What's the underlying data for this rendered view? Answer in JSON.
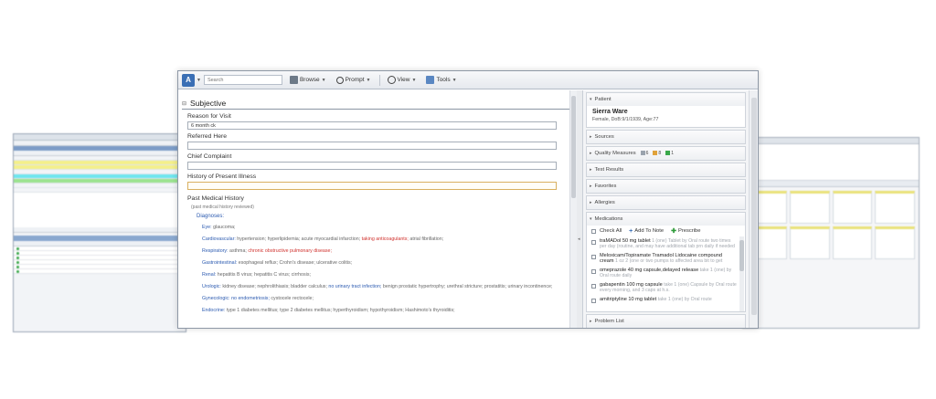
{
  "toolbar": {
    "search_placeholder": "Search",
    "browse_label": "Browse",
    "prompt_label": "Prompt",
    "view_label": "View",
    "tools_label": "Tools"
  },
  "note": {
    "section_title": "Subjective",
    "reason_label": "Reason for Visit",
    "reason_value": "6 month ck",
    "referred_label": "Referred Here",
    "chief_label": "Chief Complaint",
    "hpi_label": "History of Present Illness",
    "pmh_label": "Past Medical History",
    "pmh_sub": "(past medical history reviewed)",
    "diagnoses_label": "Diagnoses:",
    "eye": {
      "sys": "Eye:",
      "text": "glaucoma;"
    },
    "cardio": {
      "sys": "Cardiovascular:",
      "text": "hypertension;  hyperlipidemia;  acute myocardial infarction;",
      "red": "taking anticoagulants;",
      "tail": "atrial fibrillation;"
    },
    "resp": {
      "sys": "Respiratory:",
      "text": "asthma;",
      "red": "chronic obstructive pulmonary disease;"
    },
    "gi": {
      "sys": "Gastrointestinal:",
      "text": "esophageal reflux;  Crohn's disease;  ulcerative colitis;"
    },
    "renal": {
      "sys": "Renal:",
      "text": "hepatitis B virus;  hepatitis C virus;  cirrhosis;"
    },
    "uro": {
      "sys": "Urologic:",
      "text": "kidney disease;  nephrolithiasis;  bladder calculus;",
      "blue": "no urinary tract infection;",
      "tail": "benign prostatic hypertrophy;  urethral stricture;  prostatitis;",
      "tail2": "urinary incontinence;"
    },
    "gyn": {
      "sys": "Gynecologic:",
      "blue": "no endometriosis;",
      "text": "cystocele rectocele;"
    },
    "endo": {
      "sys": "Endocrine:",
      "text": "type 1 diabetes mellitus;  type 2 diabetes mellitus;  hyperthyroidism;  hypothyroidism;  Hashimoto's thyroiditis;"
    }
  },
  "panel": {
    "patient_header": "Patient",
    "patient_name": "Sierra Ware",
    "patient_info": "Female, DoB:9/1/1939, Age:77",
    "sources": "Sources",
    "quality": "Quality Measures",
    "q_counts": [
      "6",
      "8",
      "1"
    ],
    "test_results": "Test Results",
    "favorites": "Favorites",
    "allergies": "Allergies",
    "medications": "Medications",
    "check_all": "Check All",
    "add_to_note": "Add To Note",
    "prescribe": "Prescribe",
    "meds": [
      {
        "name": "traMADol 50 mg tablet",
        "sig": "1 (one) Tablet by Oral route two times per day (routine, and may have additional tab prn daily if needed"
      },
      {
        "name": "Meloxicam/Topiramate Tramadol Lidocaine compound cream",
        "sig": "1 oz 2 (one or two pumps to affected area bit to get"
      },
      {
        "name": "omeprazole 40 mg capsule,delayed release",
        "sig": "take 1 (one) by Oral route daily"
      },
      {
        "name": "gabapentin 100 mg capsule",
        "sig": "take 1 (one) Capsule by Oral route every morning, and 3 caps at h.s."
      },
      {
        "name": "amitriptyline 10 mg tablet",
        "sig": "take 1 (one) by Oral route"
      }
    ],
    "problem_list": "Problem List"
  },
  "colors": {
    "accent_blue": "#2b5ab0",
    "alert_red": "#d0312d",
    "prescribe_green": "#2f9b3a"
  }
}
